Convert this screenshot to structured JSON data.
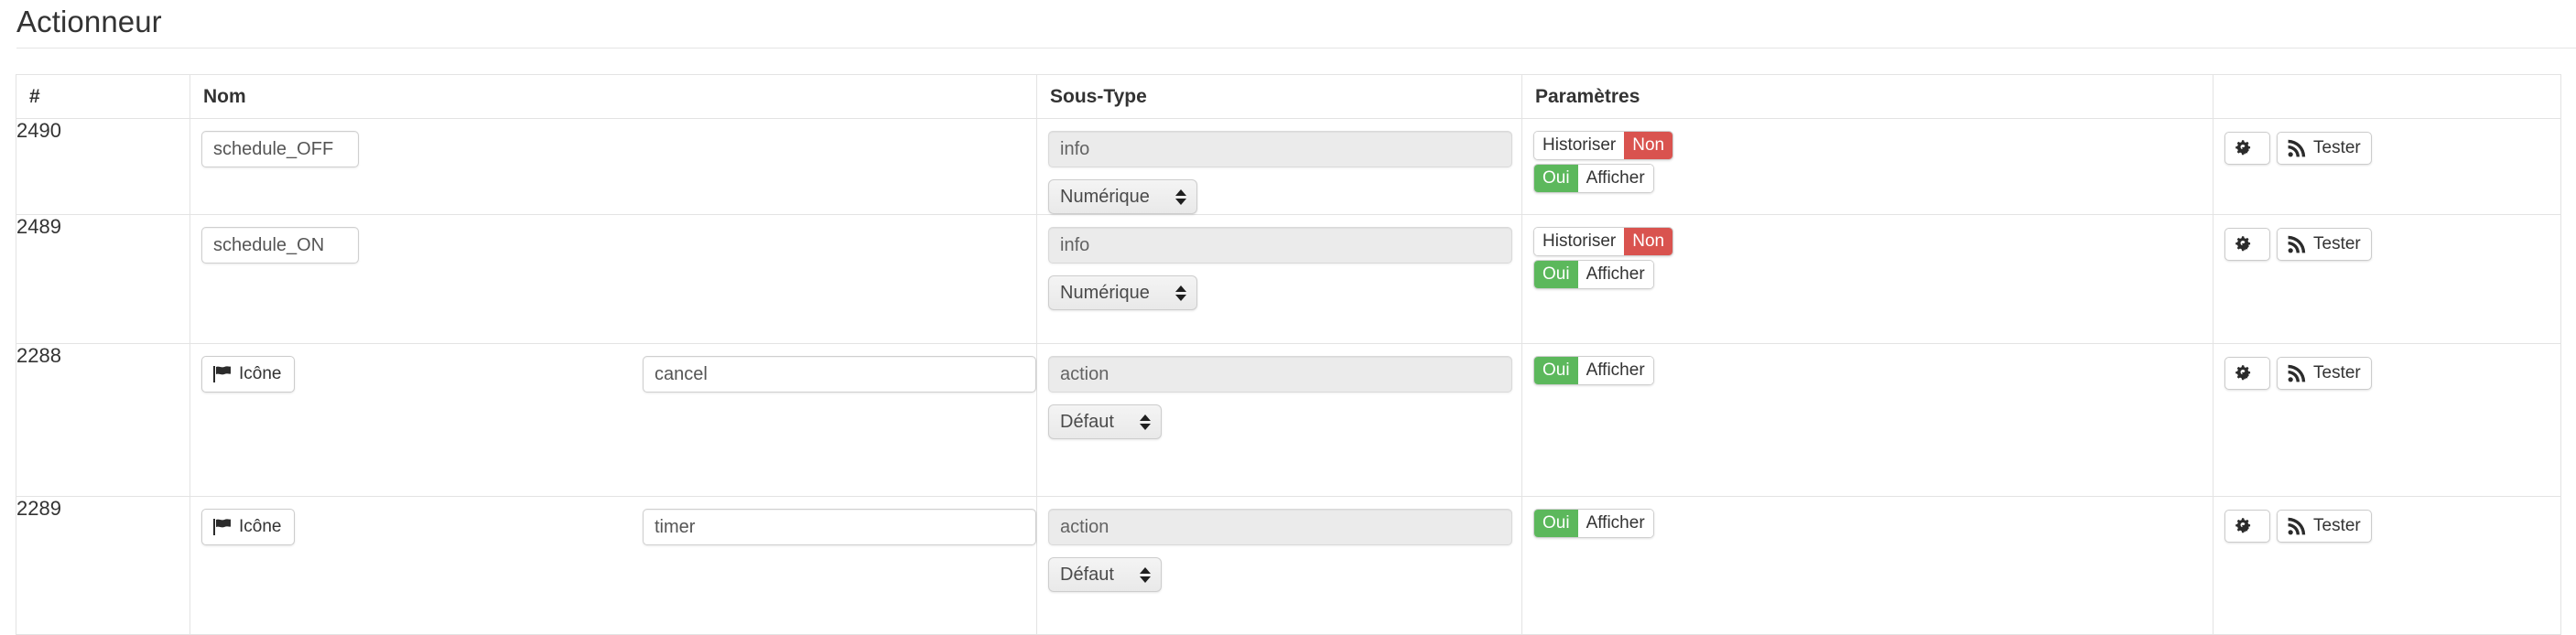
{
  "page": {
    "title": "Actionneur"
  },
  "table": {
    "headers": {
      "id": "#",
      "nom": "Nom",
      "soustype": "Sous-Type",
      "params": "Paramètres",
      "actions": ""
    },
    "rows": [
      {
        "id": "2490",
        "icon_button_label": null,
        "name_value": "schedule_OFF",
        "name_placeholder": "",
        "subtype_value": "info",
        "subtype_select_value": "Numérique",
        "params": [
          {
            "label": "Historiser",
            "value": "Non",
            "value_position": "right",
            "state": "no"
          },
          {
            "label": "Afficher",
            "value": "Oui",
            "value_position": "left",
            "state": "yes"
          }
        ],
        "actions": {
          "config_label": "",
          "test_label": "Tester"
        }
      },
      {
        "id": "2489",
        "icon_button_label": null,
        "name_value": "schedule_ON",
        "name_placeholder": "",
        "subtype_value": "info",
        "subtype_select_value": "Numérique",
        "params": [
          {
            "label": "Historiser",
            "value": "Non",
            "value_position": "right",
            "state": "no"
          },
          {
            "label": "Afficher",
            "value": "Oui",
            "value_position": "left",
            "state": "yes"
          }
        ],
        "actions": {
          "config_label": "",
          "test_label": "Tester"
        }
      },
      {
        "id": "2288",
        "icon_button_label": "Icône",
        "name_value": "cancel",
        "name_placeholder": "",
        "subtype_value": "action",
        "subtype_select_value": "Défaut",
        "params": [
          {
            "label": "Afficher",
            "value": "Oui",
            "value_position": "left",
            "state": "yes"
          }
        ],
        "actions": {
          "config_label": "",
          "test_label": "Tester"
        }
      },
      {
        "id": "2289",
        "icon_button_label": "Icône",
        "name_value": "timer",
        "name_placeholder": "",
        "subtype_value": "action",
        "subtype_select_value": "Défaut",
        "params": [
          {
            "label": "Afficher",
            "value": "Oui",
            "value_position": "left",
            "state": "yes"
          }
        ],
        "actions": {
          "config_label": "",
          "test_label": "Tester"
        }
      }
    ]
  },
  "icons": {
    "flag": "flag-icon",
    "gears": "gears-icon",
    "rss": "rss-signal-icon",
    "select_arrows": "sort-arrows-icon"
  },
  "colors": {
    "badge_no": "#d9534f",
    "badge_yes": "#5cb85c",
    "border": "#e3e3e3",
    "text": "#333333",
    "readonly_bg": "#ebebeb"
  }
}
